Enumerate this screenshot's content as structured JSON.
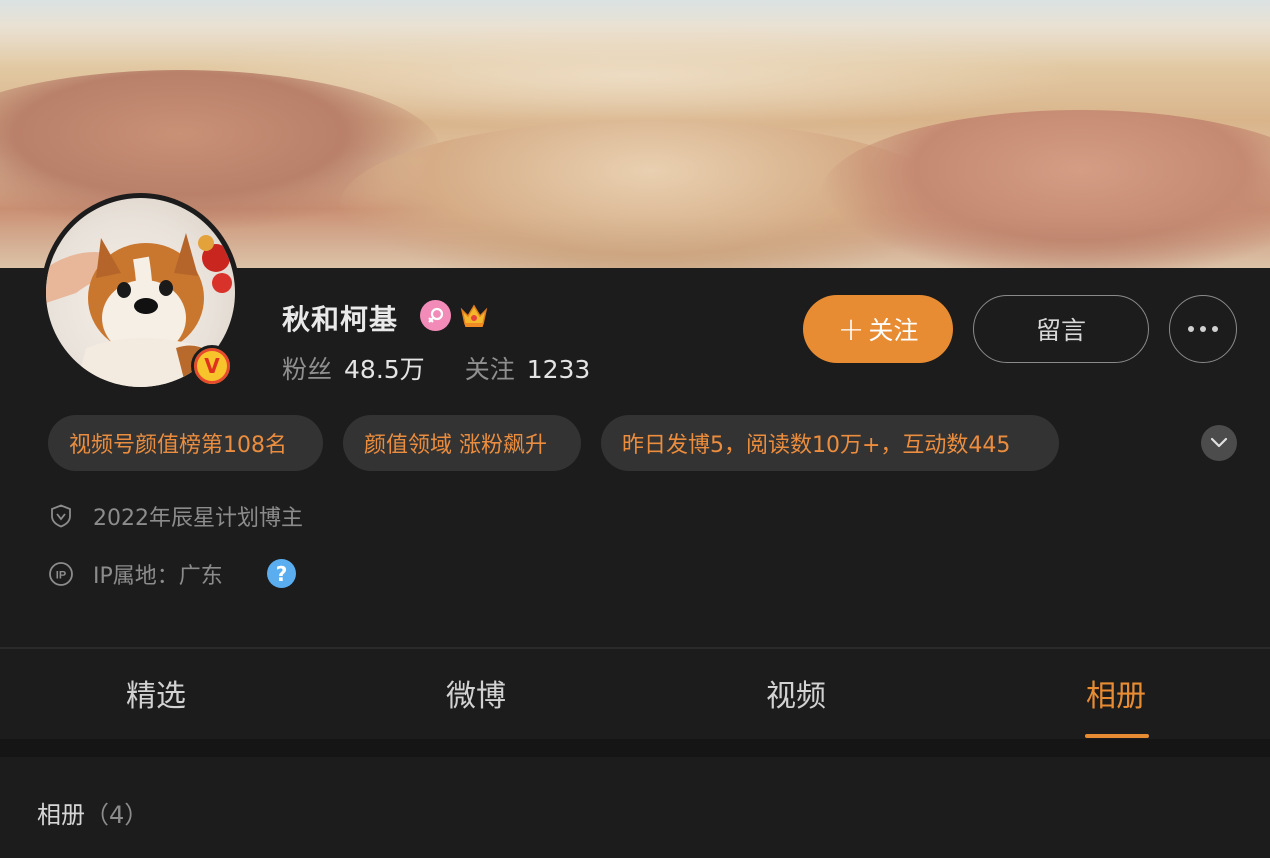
{
  "profile": {
    "name": "秋和柯基",
    "verified_badge": "V",
    "gender_icon": "female-icon",
    "crown_icon": "crown-icon",
    "followers_label": "粉丝",
    "followers_value": "48.5万",
    "following_label": "关注",
    "following_value": "1233"
  },
  "actions": {
    "follow_plus": "+",
    "follow_label": "关注",
    "message_label": "留言",
    "more_icon": "more-dots-icon"
  },
  "tags": [
    "视频号颜值榜第108名",
    "颜值领域 涨粉飙升",
    "昨日发博5，阅读数10万+，互动数445"
  ],
  "info": {
    "program": "2022年辰星计划博主",
    "ip_location": "IP属地：广东",
    "help_symbol": "?"
  },
  "tabs": [
    {
      "label": "精选",
      "active": false
    },
    {
      "label": "微博",
      "active": false
    },
    {
      "label": "视频",
      "active": false
    },
    {
      "label": "相册",
      "active": true
    }
  ],
  "album_section": {
    "title": "相册",
    "count": "（4）"
  },
  "colors": {
    "accent": "#e88c33",
    "background": "#1c1c1c",
    "tag_bg": "#333333",
    "help_blue": "#5aaef0"
  }
}
